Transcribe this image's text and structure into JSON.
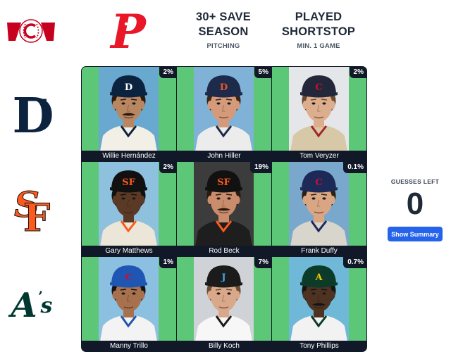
{
  "row_teams": [
    {
      "name": "Tigers",
      "logo_icon": "tigers-d-icon",
      "color": "#0c2340",
      "accent": "#fa4616"
    },
    {
      "name": "Giants",
      "logo_icon": "giants-sf-icon",
      "color": "#fd5a1e"
    },
    {
      "name": "Athletics",
      "logo_icon": "athletics-as-icon",
      "color": "#003831"
    }
  ],
  "col_teams": [
    {
      "name": "Reds",
      "logo_icon": "reds-wishbone-c-icon",
      "color": "#c6011f"
    },
    {
      "name": "Phillies",
      "logo_icon": "phillies-p-icon",
      "color": "#e81828"
    }
  ],
  "col_headers": [
    {
      "title": "30+ SAVE SEASON",
      "subtitle": "PITCHING"
    },
    {
      "title": "PLAYED SHORTSTOP",
      "subtitle": "MIN. 1 GAME"
    }
  ],
  "cells": [
    {
      "player": "Willie Hernández",
      "pct": "2%",
      "bg": "#6aa9cf",
      "cap": "#0c2340",
      "logo": "D",
      "logo_color": "#ffffff",
      "skin": "#b98662",
      "hair": "#2b1a10",
      "jersey": "#f2efe6",
      "trim": "#0c2340",
      "mustache": true
    },
    {
      "player": "John Hiller",
      "pct": "5%",
      "bg": "#7fb2d6",
      "cap": "#1e2a4a",
      "logo": "D",
      "logo_color": "#e0582a",
      "skin": "#d59a7a",
      "hair": "#3b2618",
      "jersey": "#ececec",
      "trim": "#1e2a4a",
      "mustache": false
    },
    {
      "player": "Tom Veryzer",
      "pct": "2%",
      "bg": "#e4e6ea",
      "cap": "#22273a",
      "logo": "C",
      "logo_color": "#c8102e",
      "skin": "#dcae8e",
      "hair": "#6b4a2f",
      "jersey": "#d7c8a8",
      "trim": "#a3262a",
      "mustache": false
    },
    {
      "player": "Gary Matthews",
      "pct": "2%",
      "bg": "#8ec1de",
      "cap": "#111111",
      "logo": "SF",
      "logo_color": "#fd5a1e",
      "skin": "#5b3a25",
      "hair": "#111111",
      "jersey": "#ebe6d7",
      "trim": "#fd5a1e",
      "mustache": false
    },
    {
      "player": "Rod Beck",
      "pct": "19%",
      "bg": "#3c3c3c",
      "cap": "#111111",
      "logo": "SF",
      "logo_color": "#fd5a1e",
      "skin": "#c98c6c",
      "hair": "#2a1a10",
      "jersey": "#1e1e1e",
      "trim": "#fd5a1e",
      "mustache": true
    },
    {
      "player": "Frank Duffy",
      "pct": "0.1%",
      "bg": "#7aa8cc",
      "cap": "#1d2a58",
      "logo": "C",
      "logo_color": "#c8102e",
      "skin": "#d9a684",
      "hair": "#2c2010",
      "jersey": "#d8d5cd",
      "trim": "#1d2a58",
      "mustache": false
    },
    {
      "player": "Manny Trillo",
      "pct": "1%",
      "bg": "#8cc0e0",
      "cap": "#1f56b3",
      "logo": "C",
      "logo_color": "#c8102e",
      "skin": "#a7714e",
      "hair": "#141414",
      "jersey": "#f3f3f3",
      "trim": "#1f56b3",
      "mustache": false
    },
    {
      "player": "Billy Koch",
      "pct": "7%",
      "bg": "#cfd3d7",
      "cap": "#1b1b1b",
      "logo": "J",
      "logo_color": "#3da5e0",
      "skin": "#d9a88a",
      "hair": "#6b4e32",
      "jersey": "#f7f7f7",
      "trim": "#1b1b1b",
      "mustache": false
    },
    {
      "player": "Tony Phillips",
      "pct": "0.7%",
      "bg": "#6fb8d8",
      "cap": "#0c3b2a",
      "logo": "A",
      "logo_color": "#f3c400",
      "skin": "#4e3222",
      "hair": "#141414",
      "jersey": "#f2f2f2",
      "trim": "#0c3b2a",
      "mustache": true
    }
  ],
  "guesses": {
    "label": "GUESSES LEFT",
    "count": "0"
  },
  "summary_button": {
    "label": "Show Summary"
  }
}
